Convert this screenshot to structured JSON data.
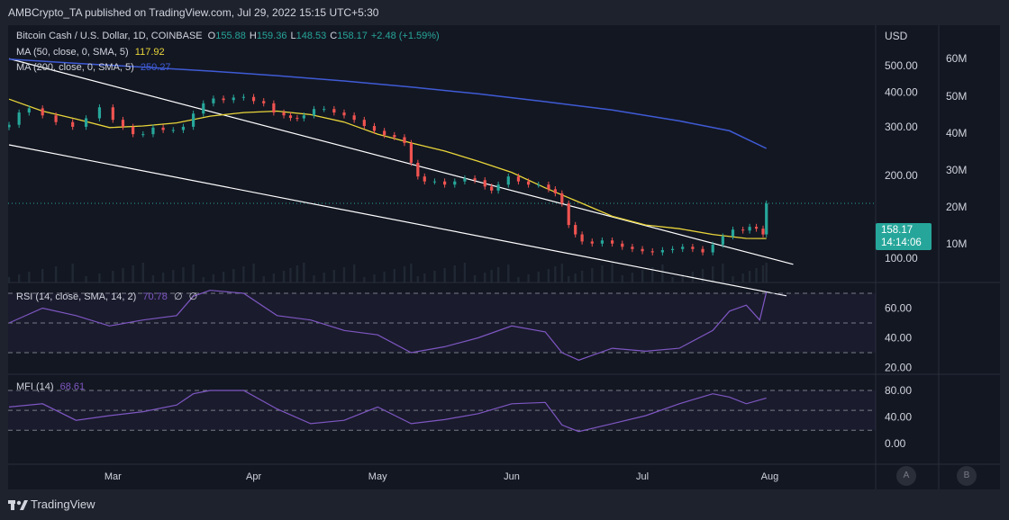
{
  "header": {
    "publish_text": "AMBCrypto_TA published on TradingView.com, Jul 29, 2022 15:15 UTC+5:30"
  },
  "main_legend": {
    "symbol": "Bitcoin Cash / U.S. Dollar, 1D, COINBASE",
    "o_label": "O",
    "o_value": "155.88",
    "h_label": "H",
    "h_value": "159.36",
    "l_label": "L",
    "l_value": "148.53",
    "c_label": "C",
    "c_value": "158.17",
    "change": "+2.48 (+1.59%)"
  },
  "ma50": {
    "label": "MA (50, close, 0, SMA, 5)",
    "value": "117.92",
    "color": "#e9d53a"
  },
  "ma200": {
    "label": "MA (200, close, 0, SMA, 5)",
    "value": "250.27",
    "color": "#3f5bd6"
  },
  "price_axis": {
    "currency": "USD",
    "ticks": [
      "500.00",
      "400.00",
      "300.00",
      "200.00",
      "100.00"
    ]
  },
  "volume_axis": {
    "ticks": [
      "60M",
      "50M",
      "40M",
      "30M",
      "20M",
      "10M"
    ]
  },
  "price_tag": {
    "price": "158.17",
    "countdown": "14:14:06",
    "color": "#26a69a"
  },
  "rsi": {
    "label": "RSI (14, close, SMA, 14, 2)",
    "value": "70.78",
    "extra1": "∅",
    "extra2": "∅",
    "ticks": [
      "60.00",
      "40.00",
      "20.00"
    ],
    "color": "#7e57c2"
  },
  "mfi": {
    "label": "MFI (14)",
    "value": "68.61",
    "ticks": [
      "80.00",
      "40.00",
      "0.00"
    ],
    "color": "#7e57c2"
  },
  "time_axis": {
    "labels": [
      "Mar",
      "Apr",
      "May",
      "Jun",
      "Jul",
      "Aug"
    ]
  },
  "scale_buttons": {
    "a": "A",
    "b": "B"
  },
  "footer": {
    "brand": "TradingView"
  },
  "colors": {
    "bull": "#26a69a",
    "bear": "#ef5350",
    "trendline": "#ffffff"
  },
  "chart_data": {
    "type": "candlestick",
    "title": "Bitcoin Cash / U.S. Dollar, 1D, COINBASE",
    "ylim": [
      60,
      560
    ],
    "y_scale": "log",
    "candle_close": [
      [
        0,
        305
      ],
      [
        3,
        338
      ],
      [
        6,
        350
      ],
      [
        10,
        330
      ],
      [
        14,
        312
      ],
      [
        19,
        300
      ],
      [
        23,
        322
      ],
      [
        27,
        353
      ],
      [
        31,
        318
      ],
      [
        34,
        300
      ],
      [
        37,
        282
      ],
      [
        40,
        282
      ],
      [
        43,
        298
      ],
      [
        46,
        292
      ],
      [
        49,
        292
      ],
      [
        52,
        300
      ],
      [
        55,
        335
      ],
      [
        58,
        365
      ],
      [
        61,
        380
      ],
      [
        64,
        375
      ],
      [
        67,
        383
      ],
      [
        70,
        385
      ],
      [
        73,
        372
      ],
      [
        76,
        365
      ],
      [
        79,
        338
      ],
      [
        82,
        330
      ],
      [
        84,
        323
      ],
      [
        86,
        322
      ],
      [
        88,
        330
      ],
      [
        91,
        348
      ],
      [
        94,
        348
      ],
      [
        97,
        338
      ],
      [
        100,
        330
      ],
      [
        103,
        318
      ],
      [
        106,
        302
      ],
      [
        109,
        290
      ],
      [
        112,
        280
      ],
      [
        115,
        275
      ],
      [
        118,
        262
      ],
      [
        120,
        222
      ],
      [
        122,
        198
      ],
      [
        124,
        190
      ],
      [
        127,
        190
      ],
      [
        130,
        185
      ],
      [
        133,
        190
      ],
      [
        136,
        195
      ],
      [
        139,
        192
      ],
      [
        142,
        182
      ],
      [
        144,
        176
      ],
      [
        146,
        185
      ],
      [
        149,
        198
      ],
      [
        152,
        190
      ],
      [
        155,
        185
      ],
      [
        158,
        185
      ],
      [
        161,
        178
      ],
      [
        163,
        172
      ],
      [
        165,
        158
      ],
      [
        167,
        132
      ],
      [
        169,
        122
      ],
      [
        171,
        115
      ],
      [
        174,
        113
      ],
      [
        177,
        116
      ],
      [
        180,
        113
      ],
      [
        183,
        110
      ],
      [
        186,
        108
      ],
      [
        189,
        106
      ],
      [
        192,
        105
      ],
      [
        195,
        107
      ],
      [
        198,
        108
      ],
      [
        201,
        110
      ],
      [
        204,
        108
      ],
      [
        207,
        105
      ],
      [
        210,
        112
      ],
      [
        213,
        120
      ],
      [
        216,
        127
      ],
      [
        219,
        126
      ],
      [
        221,
        130
      ],
      [
        223,
        128
      ],
      [
        225,
        122
      ],
      [
        226,
        158
      ]
    ],
    "ma50": [
      [
        0,
        378
      ],
      [
        10,
        342
      ],
      [
        20,
        320
      ],
      [
        30,
        298
      ],
      [
        40,
        302
      ],
      [
        50,
        310
      ],
      [
        60,
        328
      ],
      [
        70,
        338
      ],
      [
        80,
        342
      ],
      [
        90,
        332
      ],
      [
        100,
        312
      ],
      [
        110,
        282
      ],
      [
        120,
        262
      ],
      [
        130,
        245
      ],
      [
        140,
        225
      ],
      [
        150,
        205
      ],
      [
        160,
        180
      ],
      [
        170,
        160
      ],
      [
        180,
        142
      ],
      [
        190,
        132
      ],
      [
        200,
        128
      ],
      [
        210,
        122
      ],
      [
        220,
        118
      ],
      [
        226,
        117.92
      ]
    ],
    "ma200": [
      [
        0,
        528
      ],
      [
        20,
        510
      ],
      [
        40,
        494
      ],
      [
        60,
        478
      ],
      [
        80,
        460
      ],
      [
        100,
        440
      ],
      [
        120,
        418
      ],
      [
        140,
        395
      ],
      [
        160,
        370
      ],
      [
        180,
        345
      ],
      [
        200,
        315
      ],
      [
        215,
        290
      ],
      [
        226,
        250.27
      ]
    ],
    "upper_trendline": [
      [
        0,
        530
      ],
      [
        234,
        95
      ]
    ],
    "lower_trendline": [
      [
        0,
        258
      ],
      [
        232,
        73
      ]
    ],
    "rsi_series": [
      [
        0,
        50
      ],
      [
        10,
        60
      ],
      [
        20,
        55
      ],
      [
        30,
        48
      ],
      [
        40,
        52
      ],
      [
        50,
        55
      ],
      [
        55,
        68
      ],
      [
        60,
        72
      ],
      [
        70,
        70
      ],
      [
        80,
        55
      ],
      [
        90,
        52
      ],
      [
        100,
        45
      ],
      [
        110,
        42
      ],
      [
        120,
        30
      ],
      [
        130,
        34
      ],
      [
        140,
        40
      ],
      [
        150,
        48
      ],
      [
        160,
        44
      ],
      [
        165,
        30
      ],
      [
        170,
        25
      ],
      [
        180,
        33
      ],
      [
        190,
        31
      ],
      [
        200,
        33
      ],
      [
        210,
        45
      ],
      [
        215,
        58
      ],
      [
        220,
        62
      ],
      [
        224,
        52
      ],
      [
        226,
        70.78
      ]
    ],
    "mfi_series": [
      [
        0,
        55
      ],
      [
        10,
        60
      ],
      [
        20,
        35
      ],
      [
        30,
        42
      ],
      [
        40,
        48
      ],
      [
        50,
        58
      ],
      [
        55,
        75
      ],
      [
        60,
        80
      ],
      [
        70,
        80
      ],
      [
        80,
        52
      ],
      [
        90,
        30
      ],
      [
        100,
        35
      ],
      [
        110,
        55
      ],
      [
        120,
        30
      ],
      [
        130,
        36
      ],
      [
        140,
        45
      ],
      [
        150,
        60
      ],
      [
        160,
        62
      ],
      [
        165,
        28
      ],
      [
        170,
        18
      ],
      [
        180,
        30
      ],
      [
        190,
        42
      ],
      [
        200,
        60
      ],
      [
        210,
        75
      ],
      [
        215,
        70
      ],
      [
        220,
        60
      ],
      [
        226,
        68.61
      ]
    ],
    "x_labels": [
      [
        31,
        "Mar"
      ],
      [
        73,
        "Apr"
      ],
      [
        110,
        "May"
      ],
      [
        150,
        "Jun"
      ],
      [
        189,
        "Jul"
      ],
      [
        227,
        "Aug"
      ]
    ]
  }
}
